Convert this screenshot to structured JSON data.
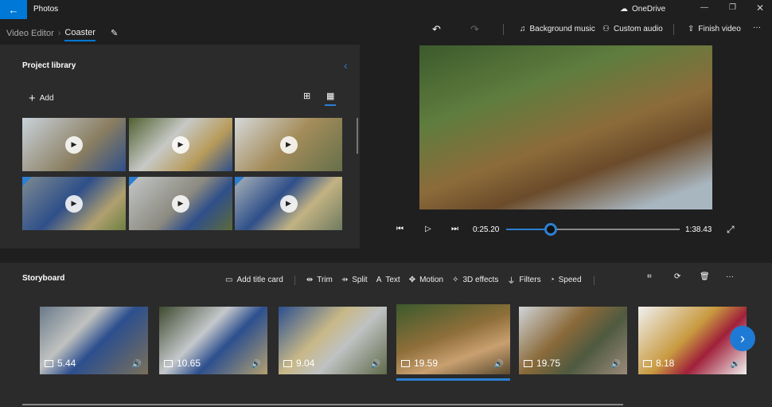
{
  "titlebar": {
    "app": "Photos",
    "onedrive": "OneDrive"
  },
  "breadcrumb": {
    "root": "Video Editor",
    "current": "Coaster"
  },
  "toolbar": {
    "background_music": "Background music",
    "custom_audio": "Custom audio",
    "finish_video": "Finish video"
  },
  "library": {
    "title": "Project library",
    "add": "Add",
    "thumbnails": [
      {
        "bg": "linear-gradient(135deg,#c9d2db,#8a7e60 60%,#2f4f8a)",
        "corner": false
      },
      {
        "bg": "linear-gradient(135deg,#506030,#c7c9c6 40%,#b89b5b 70%,#2f4f8a)",
        "corner": false
      },
      {
        "bg": "linear-gradient(135deg,#d5d8da,#a48c5a 50%,#65704a)",
        "corner": false
      },
      {
        "bg": "linear-gradient(135deg,#7d8a90,#2f4f8a 45%,#b0a070 75%,#6d8040)",
        "corner": true
      },
      {
        "bg": "linear-gradient(135deg,#c3c7c8,#8c8a80 50%,#2f4f8a 70%,#5c6a3a)",
        "corner": true
      },
      {
        "bg": "linear-gradient(135deg,#a9b2b8,#2f4f8a 40%,#c2b383 65%,#6f7a60)",
        "corner": true
      }
    ]
  },
  "player": {
    "current_time": "0:25.20",
    "total_time": "1:38.43",
    "progress": 0.255
  },
  "storyboard": {
    "title": "Storyboard",
    "tools": [
      "Add title card",
      "Trim",
      "Split",
      "Text",
      "Motion",
      "3D effects",
      "Filters",
      "Speed"
    ],
    "clips": [
      {
        "duration": "5.44",
        "bg": "linear-gradient(135deg,#6a7a8a,#c0c2c0 35%,#2c4f8e 55%,#7a705a)"
      },
      {
        "duration": "10.65",
        "bg": "linear-gradient(135deg,#3e4a30,#c5c8cb 40%,#2c4f8e 60%,#b3a070)"
      },
      {
        "duration": "9.04",
        "bg": "linear-gradient(135deg,#2c4f8e,#c8b888 40%,#bfc2c2 60%,#5f6a4a)"
      },
      {
        "duration": "19.59",
        "bg": "linear-gradient(160deg,#3c5a2c,#8f6f3a 45%,#c9a070 70%,#5a4a30)",
        "selected": true
      },
      {
        "duration": "19.75",
        "bg": "linear-gradient(135deg,#d0d4d8,#8a6a3a 40%,#4f5a40 65%,#9a8a7a)"
      },
      {
        "duration": "8.18",
        "bg": "linear-gradient(135deg,#f0f0f0,#c89a40 45%,#a0203a 65%,#f0f0f0)"
      }
    ]
  }
}
